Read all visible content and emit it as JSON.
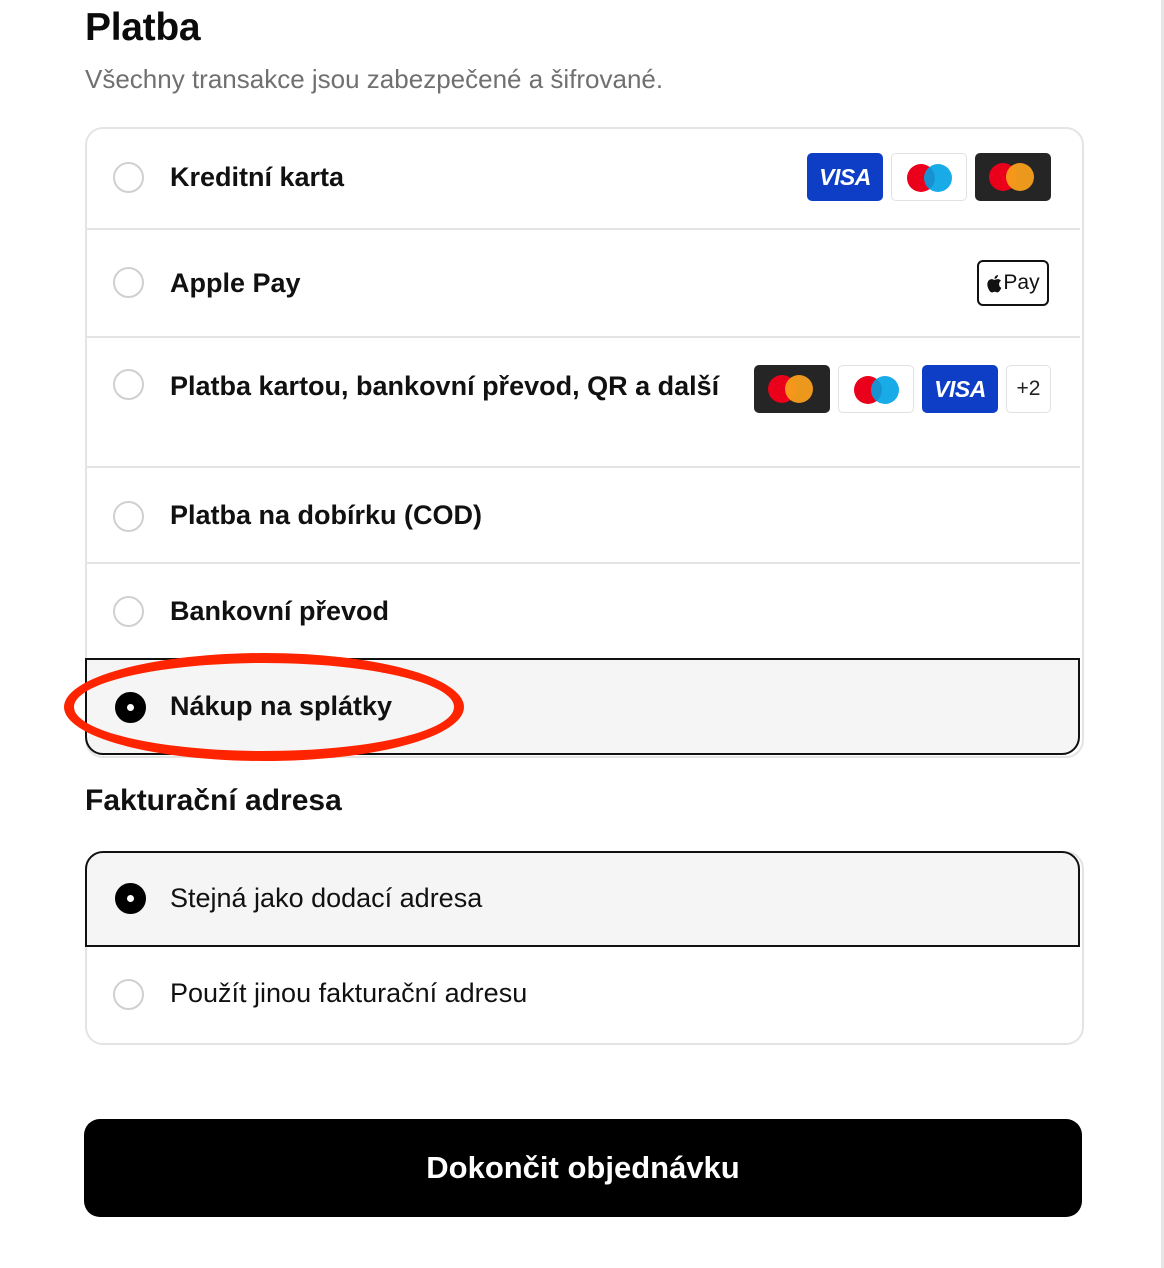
{
  "payment": {
    "title": "Platba",
    "subtitle": "Všechny transakce jsou zabezpečené a šifrované.",
    "options": [
      {
        "label": "Kreditní karta",
        "selected": false,
        "logos": [
          "visa",
          "maestro",
          "mastercard"
        ]
      },
      {
        "label": "Apple Pay",
        "selected": false,
        "logos": [
          "apple-pay"
        ]
      },
      {
        "label": "Platba kartou, bankovní převod, QR a další",
        "selected": false,
        "logos": [
          "mastercard",
          "maestro",
          "visa"
        ],
        "more": "+2"
      },
      {
        "label": "Platba na dobírku (COD)",
        "selected": false
      },
      {
        "label": "Bankovní převod",
        "selected": false
      },
      {
        "label": "Nákup na splátky",
        "selected": true
      }
    ],
    "logo_text": {
      "visa": "VISA",
      "apple_pay": "Pay"
    }
  },
  "billing": {
    "title": "Fakturační adresa",
    "options": [
      {
        "label": "Stejná jako dodací adresa",
        "selected": true
      },
      {
        "label": "Použít jinou fakturační adresu",
        "selected": false
      }
    ]
  },
  "submit": {
    "label": "Dokončit objednávku"
  },
  "annotation": {
    "color": "#ff2400"
  },
  "colors": {
    "visa_blue": "#0e3ec6",
    "mastercard_red": "#eb001b",
    "mastercard_yellow": "#f79e1b",
    "maestro_blue": "#00a2e5",
    "selected_bg": "#f5f5f5"
  }
}
